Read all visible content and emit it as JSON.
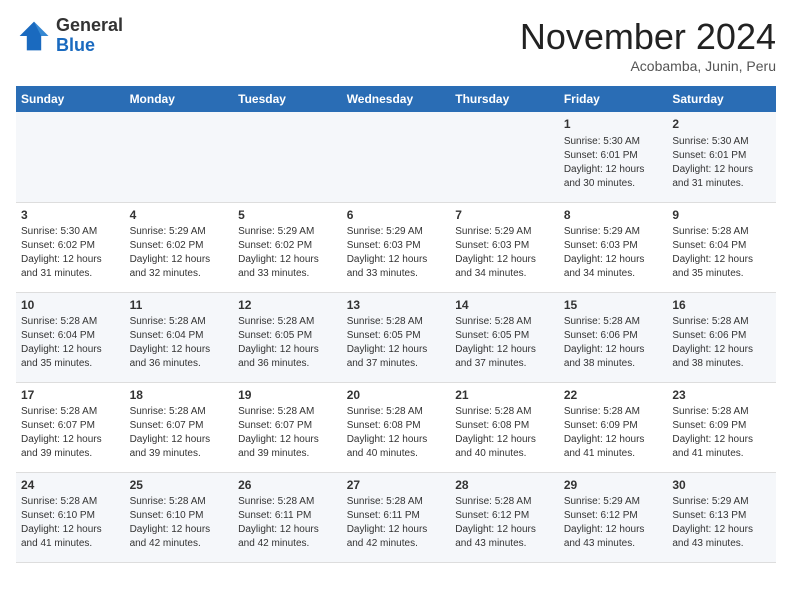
{
  "logo": {
    "general": "General",
    "blue": "Blue"
  },
  "title": "November 2024",
  "subtitle": "Acobamba, Junin, Peru",
  "days_of_week": [
    "Sunday",
    "Monday",
    "Tuesday",
    "Wednesday",
    "Thursday",
    "Friday",
    "Saturday"
  ],
  "weeks": [
    [
      {
        "day": "",
        "content": ""
      },
      {
        "day": "",
        "content": ""
      },
      {
        "day": "",
        "content": ""
      },
      {
        "day": "",
        "content": ""
      },
      {
        "day": "",
        "content": ""
      },
      {
        "day": "1",
        "content": "Sunrise: 5:30 AM\nSunset: 6:01 PM\nDaylight: 12 hours and 30 minutes."
      },
      {
        "day": "2",
        "content": "Sunrise: 5:30 AM\nSunset: 6:01 PM\nDaylight: 12 hours and 31 minutes."
      }
    ],
    [
      {
        "day": "3",
        "content": "Sunrise: 5:30 AM\nSunset: 6:02 PM\nDaylight: 12 hours and 31 minutes."
      },
      {
        "day": "4",
        "content": "Sunrise: 5:29 AM\nSunset: 6:02 PM\nDaylight: 12 hours and 32 minutes."
      },
      {
        "day": "5",
        "content": "Sunrise: 5:29 AM\nSunset: 6:02 PM\nDaylight: 12 hours and 33 minutes."
      },
      {
        "day": "6",
        "content": "Sunrise: 5:29 AM\nSunset: 6:03 PM\nDaylight: 12 hours and 33 minutes."
      },
      {
        "day": "7",
        "content": "Sunrise: 5:29 AM\nSunset: 6:03 PM\nDaylight: 12 hours and 34 minutes."
      },
      {
        "day": "8",
        "content": "Sunrise: 5:29 AM\nSunset: 6:03 PM\nDaylight: 12 hours and 34 minutes."
      },
      {
        "day": "9",
        "content": "Sunrise: 5:28 AM\nSunset: 6:04 PM\nDaylight: 12 hours and 35 minutes."
      }
    ],
    [
      {
        "day": "10",
        "content": "Sunrise: 5:28 AM\nSunset: 6:04 PM\nDaylight: 12 hours and 35 minutes."
      },
      {
        "day": "11",
        "content": "Sunrise: 5:28 AM\nSunset: 6:04 PM\nDaylight: 12 hours and 36 minutes."
      },
      {
        "day": "12",
        "content": "Sunrise: 5:28 AM\nSunset: 6:05 PM\nDaylight: 12 hours and 36 minutes."
      },
      {
        "day": "13",
        "content": "Sunrise: 5:28 AM\nSunset: 6:05 PM\nDaylight: 12 hours and 37 minutes."
      },
      {
        "day": "14",
        "content": "Sunrise: 5:28 AM\nSunset: 6:05 PM\nDaylight: 12 hours and 37 minutes."
      },
      {
        "day": "15",
        "content": "Sunrise: 5:28 AM\nSunset: 6:06 PM\nDaylight: 12 hours and 38 minutes."
      },
      {
        "day": "16",
        "content": "Sunrise: 5:28 AM\nSunset: 6:06 PM\nDaylight: 12 hours and 38 minutes."
      }
    ],
    [
      {
        "day": "17",
        "content": "Sunrise: 5:28 AM\nSunset: 6:07 PM\nDaylight: 12 hours and 39 minutes."
      },
      {
        "day": "18",
        "content": "Sunrise: 5:28 AM\nSunset: 6:07 PM\nDaylight: 12 hours and 39 minutes."
      },
      {
        "day": "19",
        "content": "Sunrise: 5:28 AM\nSunset: 6:07 PM\nDaylight: 12 hours and 39 minutes."
      },
      {
        "day": "20",
        "content": "Sunrise: 5:28 AM\nSunset: 6:08 PM\nDaylight: 12 hours and 40 minutes."
      },
      {
        "day": "21",
        "content": "Sunrise: 5:28 AM\nSunset: 6:08 PM\nDaylight: 12 hours and 40 minutes."
      },
      {
        "day": "22",
        "content": "Sunrise: 5:28 AM\nSunset: 6:09 PM\nDaylight: 12 hours and 41 minutes."
      },
      {
        "day": "23",
        "content": "Sunrise: 5:28 AM\nSunset: 6:09 PM\nDaylight: 12 hours and 41 minutes."
      }
    ],
    [
      {
        "day": "24",
        "content": "Sunrise: 5:28 AM\nSunset: 6:10 PM\nDaylight: 12 hours and 41 minutes."
      },
      {
        "day": "25",
        "content": "Sunrise: 5:28 AM\nSunset: 6:10 PM\nDaylight: 12 hours and 42 minutes."
      },
      {
        "day": "26",
        "content": "Sunrise: 5:28 AM\nSunset: 6:11 PM\nDaylight: 12 hours and 42 minutes."
      },
      {
        "day": "27",
        "content": "Sunrise: 5:28 AM\nSunset: 6:11 PM\nDaylight: 12 hours and 42 minutes."
      },
      {
        "day": "28",
        "content": "Sunrise: 5:28 AM\nSunset: 6:12 PM\nDaylight: 12 hours and 43 minutes."
      },
      {
        "day": "29",
        "content": "Sunrise: 5:29 AM\nSunset: 6:12 PM\nDaylight: 12 hours and 43 minutes."
      },
      {
        "day": "30",
        "content": "Sunrise: 5:29 AM\nSunset: 6:13 PM\nDaylight: 12 hours and 43 minutes."
      }
    ]
  ]
}
